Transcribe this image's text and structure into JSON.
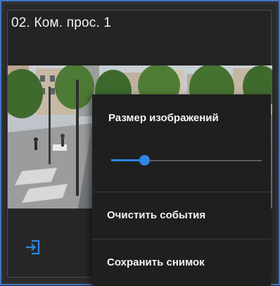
{
  "tile": {
    "title": "02. Ком. прос. 1"
  },
  "context_menu": {
    "image_size_label": "Размер изображений",
    "image_size_value": 0.22,
    "items": [
      {
        "label": "Очистить события"
      },
      {
        "label": "Сохранить снимок"
      }
    ]
  },
  "colors": {
    "frame_border": "#3f74c4",
    "accent": "#2f86e0",
    "menu_background": "#1f1f1f",
    "text": "#f4f4f4"
  },
  "icons": {
    "footer_action": "login-icon"
  }
}
